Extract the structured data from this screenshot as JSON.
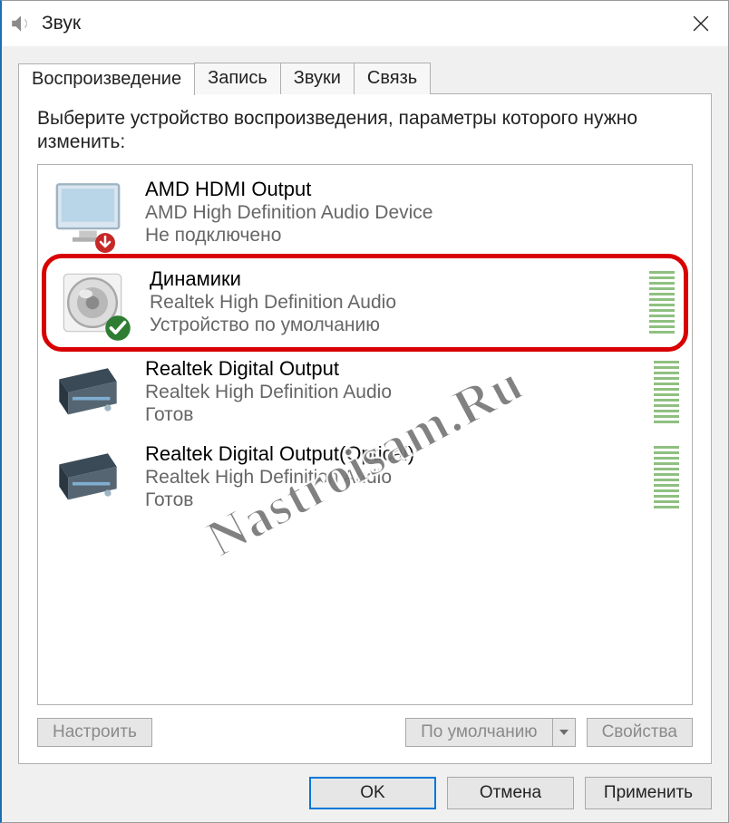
{
  "window": {
    "title": "Звук",
    "close_label": "Close"
  },
  "tabs": [
    {
      "label": "Воспроизведение",
      "active": true
    },
    {
      "label": "Запись",
      "active": false
    },
    {
      "label": "Звуки",
      "active": false
    },
    {
      "label": "Связь",
      "active": false
    }
  ],
  "instruction": "Выберите устройство воспроизведения, параметры которого нужно изменить:",
  "devices": [
    {
      "name": "AMD HDMI Output",
      "sub": "AMD High Definition Audio Device",
      "status": "Не подключено",
      "icon": "monitor",
      "overlay": "down",
      "meter": false,
      "highlighted": false
    },
    {
      "name": "Динамики",
      "sub": "Realtek High Definition Audio",
      "status": "Устройство по умолчанию",
      "icon": "speaker",
      "overlay": "check",
      "meter": true,
      "highlighted": true
    },
    {
      "name": "Realtek Digital Output",
      "sub": "Realtek High Definition Audio",
      "status": "Готов",
      "icon": "receiver",
      "overlay": null,
      "meter": true,
      "highlighted": false
    },
    {
      "name": "Realtek Digital Output(Optical)",
      "sub": "Realtek High Definition Audio",
      "status": "Готов",
      "icon": "receiver",
      "overlay": null,
      "meter": true,
      "highlighted": false
    }
  ],
  "panel_buttons": {
    "configure": "Настроить",
    "set_default": "По умолчанию",
    "properties": "Свойства"
  },
  "dialog_buttons": {
    "ok": "OK",
    "cancel": "Отмена",
    "apply": "Применить"
  },
  "watermark": "Nastroisam.Ru"
}
